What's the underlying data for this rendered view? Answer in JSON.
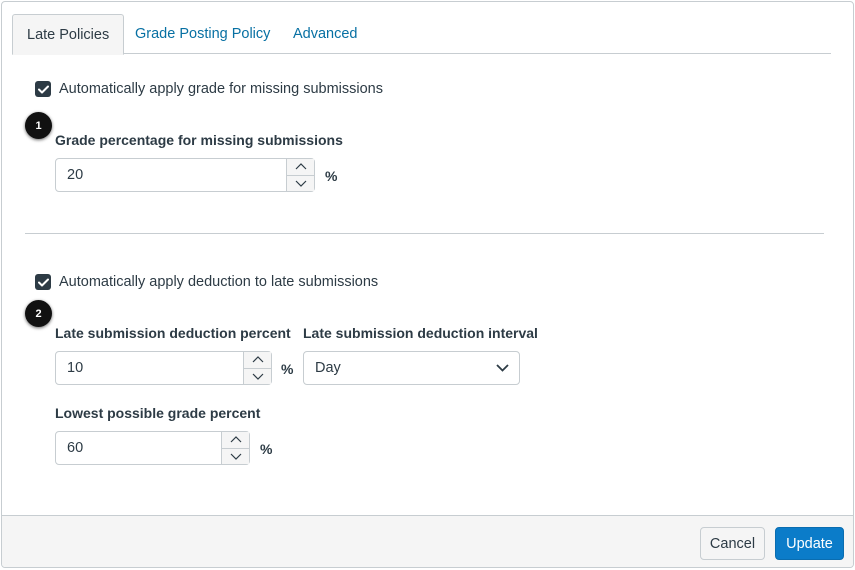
{
  "tabs": [
    {
      "label": "Late Policies",
      "active": true
    },
    {
      "label": "Grade Posting Policy",
      "active": false
    },
    {
      "label": "Advanced",
      "active": false
    }
  ],
  "missing": {
    "checkbox_label": "Automatically apply grade for missing submissions",
    "checked": true,
    "badge": "1",
    "field_label": "Grade percentage for missing submissions",
    "value": "20",
    "unit": "%"
  },
  "late": {
    "checkbox_label": "Automatically apply deduction to late submissions",
    "checked": true,
    "badge": "2",
    "deduction_label": "Late submission deduction percent",
    "deduction_value": "10",
    "deduction_unit": "%",
    "interval_label": "Late submission deduction interval",
    "interval_value": "Day",
    "lowest_label": "Lowest possible grade percent",
    "lowest_value": "60",
    "lowest_unit": "%"
  },
  "footer": {
    "cancel_label": "Cancel",
    "update_label": "Update"
  },
  "colors": {
    "link": "#0770a3",
    "primary_button": "#0b7cc9",
    "text": "#2d3b45",
    "border": "#c7cdd1"
  }
}
